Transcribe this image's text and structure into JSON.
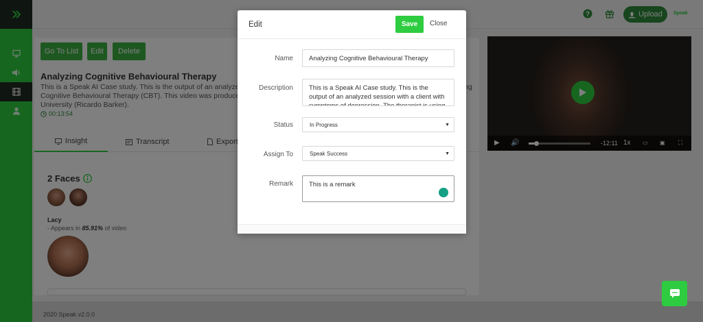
{
  "topbar": {
    "upload_label": "Upload",
    "brand": "Speak"
  },
  "main": {
    "buttons": {
      "go_to_list": "Go To List",
      "edit": "Edit",
      "delete": "Delete"
    },
    "title": "Analyzing Cognitive Behavioural Therapy",
    "description": "This is a Speak AI Case study. This is the output of an analyzed Cognitive Behavioural Therapy (CBT). This video was produced University (Ricardo Barker).",
    "description_right": "ng",
    "duration": "00:13:54",
    "tabs": [
      {
        "label": "Insight"
      },
      {
        "label": "Transcript"
      },
      {
        "label": "Export"
      }
    ],
    "faces_title": "2 Faces",
    "person_name": "Lacy",
    "appears_prefix": "- Appears in ",
    "appears_pct": "85.91%",
    "appears_suffix": " of video"
  },
  "video": {
    "time_remaining": "-12:11",
    "speed": "1x",
    "progress": 0.12
  },
  "footer": {
    "text": "2020 Speak v2.0.0"
  },
  "modal": {
    "title": "Edit",
    "save_label": "Save",
    "close_label": "Close",
    "fields": {
      "name": {
        "label": "Name",
        "value": "Analyzing Cognitive Behavioural Therapy"
      },
      "description": {
        "label": "Description",
        "value": "This is a Speak AI Case study. This is the output of an analyzed session with a client with symptoms of depression. The therapist is using"
      },
      "status": {
        "label": "Status",
        "value": "In Progress"
      },
      "assign": {
        "label": "Assign To",
        "value": "Speak Success"
      },
      "remark": {
        "label": "Remark",
        "value": "This is a remark"
      }
    }
  },
  "colors": {
    "accent": "#2ecc40",
    "dark": "#1e2a22"
  }
}
